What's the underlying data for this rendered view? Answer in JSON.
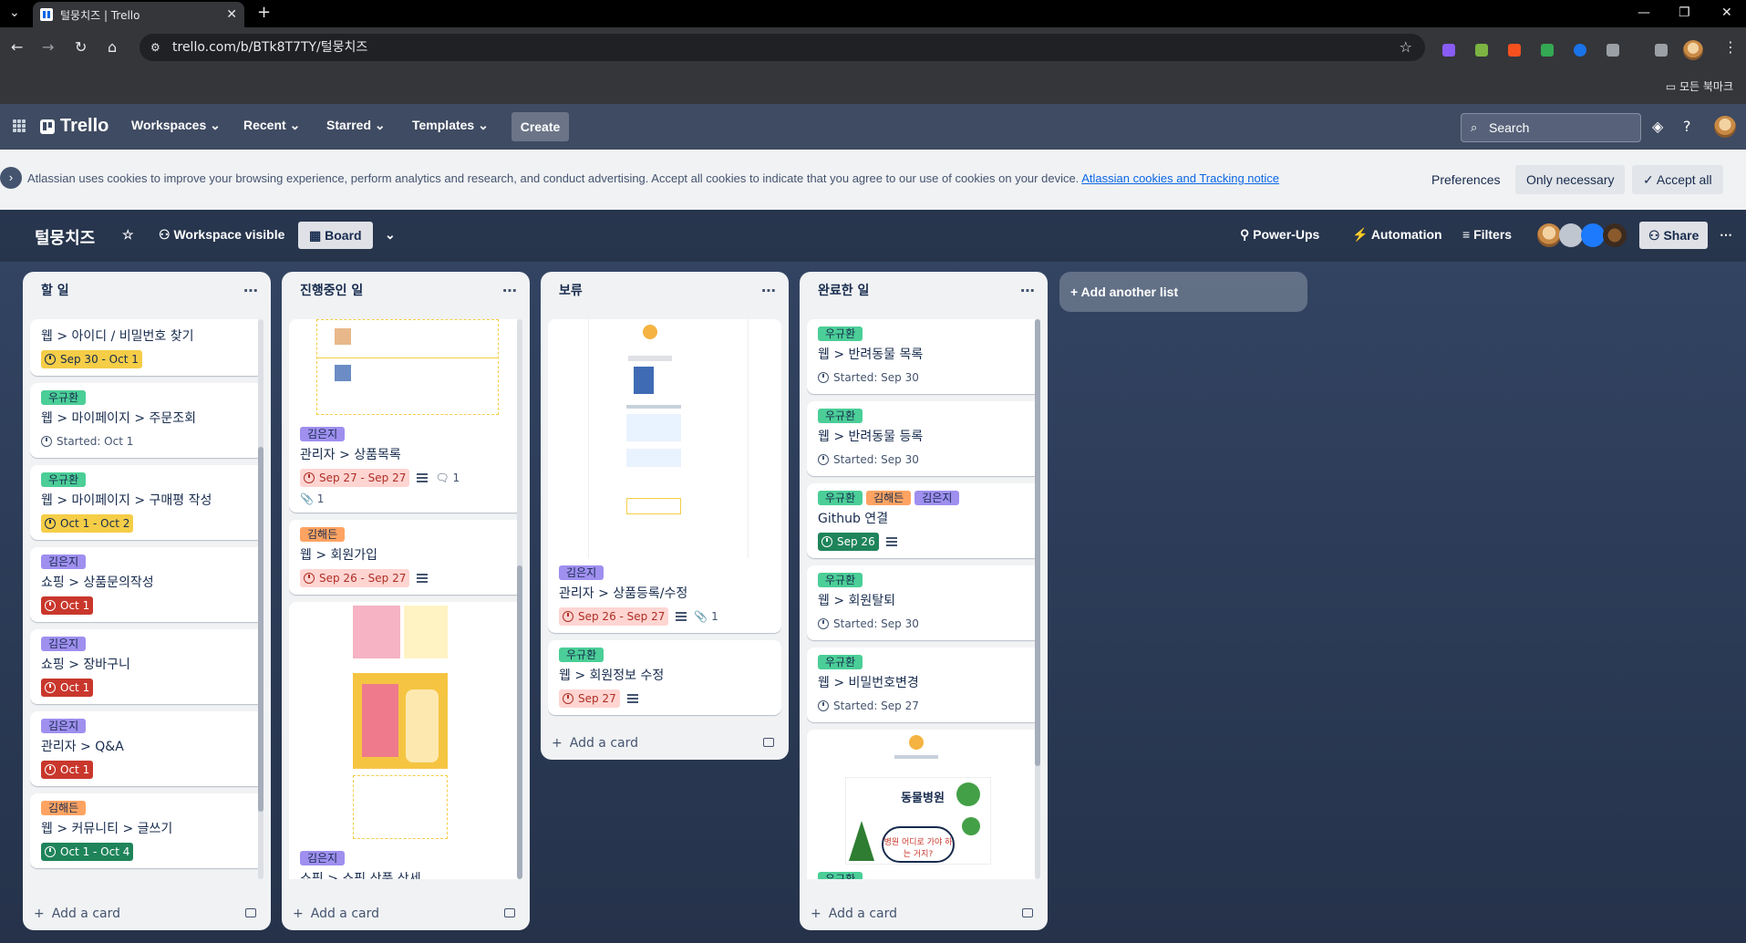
{
  "browser": {
    "tab_title": "털뭉치즈 | Trello",
    "url": "trello.com/b/BTk8T7TY/털뭉치즈",
    "bookmarks_label": "모든 북마크"
  },
  "header": {
    "logo": "Trello",
    "menus": [
      "Workspaces",
      "Recent",
      "Starred",
      "Templates"
    ],
    "create": "Create",
    "search_placeholder": "Search"
  },
  "cookie": {
    "message": "Atlassian uses cookies to improve your browsing experience, perform analytics and research, and conduct advertising. Accept all cookies to indicate that you agree to our use of cookies on your device.",
    "link": "Atlassian cookies and Tracking notice",
    "preferences": "Preferences",
    "only_necessary": "Only necessary",
    "accept_all": "Accept all"
  },
  "board": {
    "name": "털뭉치즈",
    "visibility": "Workspace visible",
    "view": "Board",
    "powerups": "Power-Ups",
    "automation": "Automation",
    "filters": "Filters",
    "share": "Share",
    "add_list": "Add another list",
    "add_card": "Add a card"
  },
  "lists": [
    {
      "title": "할 일",
      "cards": [
        {
          "labels": [],
          "title": "웹 > 아이디 / 비밀번호 찾기",
          "due": "Sep 30 - Oct 1",
          "due_style": "yellow"
        },
        {
          "labels": [
            "우규환"
          ],
          "title": "웹 > 마이페이지 > 주문조회",
          "due": "Started: Oct 1",
          "due_style": "plain"
        },
        {
          "labels": [
            "우규환"
          ],
          "title": "웹 > 마이페이지 > 구매평 작성",
          "due": "Oct 1 - Oct 2",
          "due_style": "yellow"
        },
        {
          "labels": [
            "김은지"
          ],
          "title": "쇼핑 > 상품문의작성",
          "due": "Oct 1",
          "due_style": "red"
        },
        {
          "labels": [
            "김은지"
          ],
          "title": "쇼핑 > 장바구니",
          "due": "Oct 1",
          "due_style": "red"
        },
        {
          "labels": [
            "김은지"
          ],
          "title": "관리자 > Q&A",
          "due": "Oct 1",
          "due_style": "red"
        },
        {
          "labels": [
            "김해든"
          ],
          "title": "웹 > 커뮤니티 > 글쓰기",
          "due": "Oct 1 - Oct 4",
          "due_style": "green"
        }
      ]
    },
    {
      "title": "진행중인 일",
      "cards": [
        {
          "labels": [
            "김은지"
          ],
          "title": "관리자 > 상품목록",
          "due": "Sep 27 - Sep 27",
          "due_style": "redlight",
          "comments": "1",
          "attachments": "1"
        },
        {
          "labels": [
            "김해든"
          ],
          "title": "웹 > 회원가입",
          "due": "Sep 26 - Sep 27",
          "due_style": "redlight"
        },
        {
          "labels": [
            "김은지"
          ],
          "title": "쇼핑 > 쇼핑 상품 상세",
          "due": "",
          "due_style": ""
        }
      ]
    },
    {
      "title": "보류",
      "cards": [
        {
          "labels": [
            "김은지"
          ],
          "title": "관리자 > 상품등록/수정",
          "due": "Sep 26 - Sep 27",
          "due_style": "redlight",
          "attachments": "1"
        },
        {
          "labels": [
            "우규환"
          ],
          "title": "웹 > 회원정보 수정",
          "due": "Sep 27",
          "due_style": "redlight"
        }
      ]
    },
    {
      "title": "완료한 일",
      "cards": [
        {
          "labels": [
            "우규환"
          ],
          "title": "웹 > 반려동물 목록",
          "due": "Started: Sep 30",
          "due_style": "plain"
        },
        {
          "labels": [
            "우규환"
          ],
          "title": "웹 > 반려동물 등록",
          "due": "Started: Sep 30",
          "due_style": "plain"
        },
        {
          "labels": [
            "우규환",
            "김해든",
            "김은지"
          ],
          "title": "Github 연결",
          "due": "Sep 26",
          "due_style": "green"
        },
        {
          "labels": [
            "우규환"
          ],
          "title": "웹 > 회원탈퇴",
          "due": "Started: Sep 30",
          "due_style": "plain"
        },
        {
          "labels": [
            "우규환"
          ],
          "title": "웹 > 비밀번호변경",
          "due": "Started: Sep 27",
          "due_style": "plain"
        },
        {
          "labels": [
            "우규환"
          ],
          "title": "",
          "due": "",
          "due_style": "",
          "cover_text": "동물병원",
          "cover_sub": "병원 어디로 가야 하는 거지?"
        }
      ]
    }
  ],
  "label_colors": {
    "우규환": "#4bce97",
    "김해든": "#fea362",
    "김은지": "#9f8fef"
  }
}
